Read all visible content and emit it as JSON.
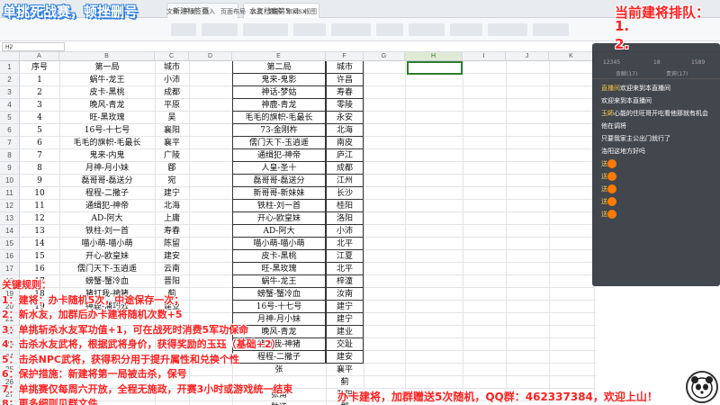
{
  "overlay": {
    "top_left": "单挑死战赛，顿挫删号",
    "queue_title": "当前建将排队：",
    "queue_items": [
      "1.",
      "2."
    ],
    "rules_title": "关键规则：",
    "rules": [
      "1：建将：办卡随机5次，中途保存一次；",
      "2：新水友，加群后办卡建将随机次数+5",
      "3：单挑斩杀水友军功值+1，可在战死时消费5军功保命",
      "4：击杀水友武将，根据武将身价，获得奖励的玉珏（基础+2）",
      "5：击杀NPC武将，获得积分用于提升属性和兑换个性",
      "6：保护措施：新建将第一局被击杀，保号",
      "7：单挑赛仅每周六开放，全程无施政，开赛3小时或游戏统一结束",
      "8：更多细则见群文件"
    ],
    "bottom_banner": "办卡建将，加群赠送5次随机，QQ群：462337384，欢迎上山！"
  },
  "window": {
    "tab1": "新建标签页",
    "tab2": "水友档案第5.xlsx"
  },
  "menus": [
    "文件",
    "开始",
    "插入",
    "页面布局",
    "公式",
    "数据",
    "审阅",
    "视图"
  ],
  "formula": {
    "cellref": "H2"
  },
  "columns": [
    "A",
    "B",
    "C",
    "D",
    "E",
    "F",
    "G",
    "H",
    "I",
    "J",
    "K"
  ],
  "rows": [
    "1",
    "2",
    "3",
    "4",
    "5",
    "6",
    "7",
    "8",
    "9",
    "10",
    "11",
    "12",
    "13",
    "14",
    "15",
    "16",
    "17",
    "18",
    "19",
    "20",
    "21",
    "22",
    "23",
    "24",
    "25",
    "26",
    "27",
    "28"
  ],
  "table1": {
    "headers": [
      "序号",
      "第一局",
      "城市"
    ],
    "rows": [
      [
        "1",
        "蜗牛-龙王",
        "小沛"
      ],
      [
        "2",
        "皮卡-黑桃",
        "成都"
      ],
      [
        "3",
        "晚风-青龙",
        "平原"
      ],
      [
        "4",
        "旺-黑玫瑰",
        "吴"
      ],
      [
        "5",
        "16号-十七号",
        "襄阳"
      ],
      [
        "6",
        "毛毛的旗帜-毛最长",
        "襄平"
      ],
      [
        "7",
        "鬼来-内鬼",
        "广陵"
      ],
      [
        "8",
        "月神-月小妹",
        "郿"
      ],
      [
        "9",
        "磊哥哥-磊送分",
        "宛"
      ],
      [
        "10",
        "程程-二撒子",
        "建宁"
      ],
      [
        "11",
        "通缉犯-神帝",
        "北海"
      ],
      [
        "12",
        "AD-阿大",
        "上庸"
      ],
      [
        "13",
        "铁柱-刘一首",
        "寿春"
      ],
      [
        "14",
        "喵小萌-喵小萌",
        "陈留"
      ],
      [
        "15",
        "开心-欧皇妹",
        "建安"
      ],
      [
        "16",
        "儒门天下-玉逍遥",
        "云南"
      ],
      [
        "17",
        "螃蟹-蟹冷血",
        "晋阳"
      ],
      [
        "18",
        "猪打我-神猪",
        "蓟"
      ],
      [
        "19",
        "神鹿-潘巧云",
        "建业"
      ]
    ]
  },
  "table2": {
    "headers": [
      "第二局",
      "城市"
    ],
    "rows": [
      [
        "鬼来-鬼影",
        "许昌"
      ],
      [
        "神话-梦姑",
        "寿春"
      ],
      [
        "神鹿-青龙",
        "零陵"
      ],
      [
        "毛毛的旗帜-毛最长",
        "永安"
      ],
      [
        "73-金刚杵",
        "北海"
      ],
      [
        "儒门天下-玉逍遥",
        "南皮"
      ],
      [
        "通缉犯-神帝",
        "庐江"
      ],
      [
        "人皇-圣十",
        "成都"
      ],
      [
        "磊哥哥-磊送分",
        "江州"
      ],
      [
        "新哥哥-新妹妹",
        "长沙"
      ],
      [
        "铁柱-刘一首",
        "桂阳"
      ],
      [
        "开心-欧皇妹",
        "洛阳"
      ],
      [
        "AD-阿大",
        "小沛"
      ],
      [
        "喵小萌-喵小萌",
        "北平"
      ],
      [
        "皮卡-黑桃",
        "江夏"
      ],
      [
        "旺-黑玫瑰",
        "北平"
      ],
      [
        "蜗牛-龙王",
        "梓潼"
      ],
      [
        "螃蟹-蟹冷血",
        "汝南"
      ],
      [
        "16号-十七号",
        "建宁"
      ],
      [
        "月神-月小妹",
        "建宁"
      ],
      [
        "晚风-青龙",
        "建业"
      ],
      [
        "猪打我-神猪",
        "交趾"
      ],
      [
        "程程-二撒子",
        "建安"
      ]
    ]
  },
  "extra_col": [
    [
      "张",
      "襄平"
    ],
    [
      "",
      "蓟"
    ],
    [
      "张角",
      "晋阳"
    ],
    [
      "助道",
      "郡"
    ]
  ],
  "chat": {
    "stats": [
      "12345",
      "18",
      "1589"
    ],
    "tabs": [
      "贡献(17)",
      "贵宾(17)"
    ],
    "messages": [
      {
        "user": "直播间",
        "text": "欢迎来到本直播间"
      },
      {
        "user": "",
        "text": "欢迎来到本直播间"
      },
      {
        "user": "玉師",
        "text": "心能的住旺哥开吃看他那就有机会"
      },
      {
        "user": "",
        "text": "他在调将"
      },
      {
        "user": "",
        "text": "只要我家主公出门就行了"
      },
      {
        "user": "",
        "text": "洛阳这地方好吗"
      },
      {
        "user": "送",
        "text": ""
      },
      {
        "user": "送",
        "text": ""
      },
      {
        "user": "送",
        "text": ""
      },
      {
        "user": "送",
        "text": ""
      },
      {
        "user": "送",
        "text": ""
      }
    ]
  }
}
